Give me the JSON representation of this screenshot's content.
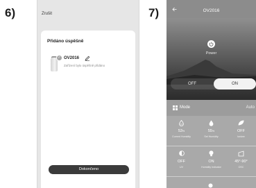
{
  "steps": {
    "left": "6)",
    "right": "7)"
  },
  "screen6": {
    "cancel_label": "Zrušit",
    "success_title": "Přidáno úspěšně",
    "device_name": "OV2016",
    "device_message": "Zařízení bylo úspěšně přidáno",
    "done_button": "Dokončeno"
  },
  "screen7": {
    "title": "OV2016",
    "power_label": "Power",
    "off_label": "OFF",
    "on_label": "ON",
    "mode_label": "Mode",
    "mode_value": "Auto",
    "tiles_row1": [
      {
        "value": "53",
        "unit": "%",
        "label": "Current Humidity",
        "icon": "droplet-outline-icon"
      },
      {
        "value": "55",
        "unit": "%",
        "label": "Set Humidity",
        "icon": "droplet-icon"
      },
      {
        "value": "OFF",
        "unit": "",
        "label": "Ionizer",
        "icon": "leaf-icon"
      }
    ],
    "tiles_row2": [
      {
        "value": "OFF",
        "unit": "",
        "label": "UV",
        "icon": "half-circle-icon"
      },
      {
        "value": "ON",
        "unit": "",
        "label": "Humidity Indicator",
        "icon": "bulb-icon"
      },
      {
        "value": "45°-90°",
        "unit": "",
        "label": "OSC",
        "icon": "oscillation-icon"
      }
    ]
  }
}
